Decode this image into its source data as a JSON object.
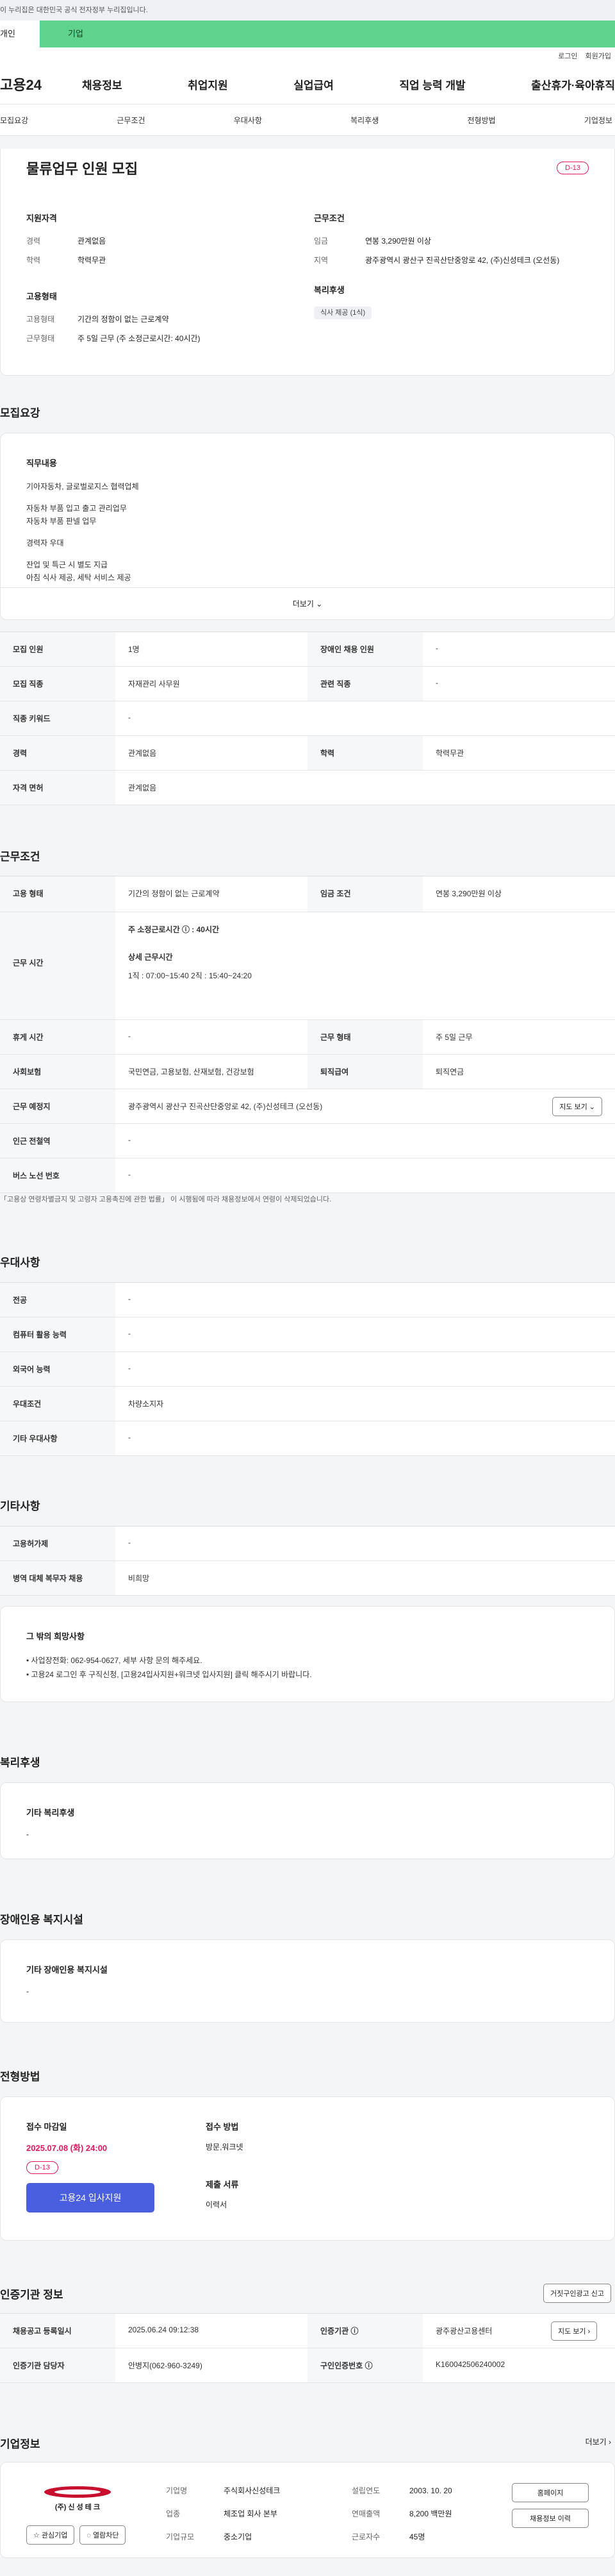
{
  "banner": "이 누리집은 대한민국 공식 전자정부 누리집입니다.",
  "tabs": {
    "person": "개인",
    "biz": "기업"
  },
  "util": {
    "login": "로그인",
    "signup": "회원가입"
  },
  "gnb": {
    "logo": "고용24",
    "menu": [
      "채용정보",
      "취업지원",
      "실업급여",
      "직업 능력 개발",
      "출산휴가·육아휴직"
    ]
  },
  "subnav": [
    "모집요강",
    "근무조건",
    "우대사항",
    "복리후생",
    "전형방법",
    "기업정보"
  ],
  "summary": {
    "title": "물류업무 인원 모집",
    "dday": "D-13",
    "qual_title": "지원자격",
    "career_lbl": "경력",
    "career": "관계없음",
    "edu_lbl": "학력",
    "edu": "학력무관",
    "cond_title": "근무조건",
    "wage_lbl": "임금",
    "wage": "연봉 3,290만원 이상",
    "region_lbl": "지역",
    "region": "광주광역시 광산구 진곡산단중앙로 42, (주)신성테크 (오선동)",
    "emp_title": "고용형태",
    "type_lbl": "고용형태",
    "type": "기간의 정함이 없는 근로계약",
    "hours_lbl": "근무형태",
    "hours": "주 5일 근무 (주 소정근로시간: 40시간)",
    "welfare_title": "복리후생",
    "welfare_tag": "식사 제공 (1식)"
  },
  "recruit": {
    "title": "모집요강",
    "box_title": "직무내용",
    "lines": [
      "기아자동차, 글로벌로지스 협력업체",
      "자동차 부품 입고 출고 관리업무",
      "자동차 부품 판넬 업무",
      "경력자 우대",
      "잔업 및 특근 시 별도 지급",
      "아침 식사 제공, 세탁 서비스 제공"
    ],
    "more": "더보기 ⌄",
    "rows": [
      {
        "l1": "모집 인원",
        "v1": "1명",
        "l2": "장애인 채용 인원",
        "v2": "-"
      },
      {
        "l1": "모집 직종",
        "v1": "자재관리 사무원",
        "l2": "관련 직종",
        "v2": "-"
      },
      {
        "l1": "직종 키워드",
        "v1": "-"
      },
      {
        "l1": "경력",
        "v1": "관계없음",
        "l2": "학력",
        "v2": "학력무관"
      },
      {
        "l1": "자격 면허",
        "v1": "관계없음"
      }
    ]
  },
  "workcond": {
    "title": "근무조건",
    "emp_lbl": "고용 형태",
    "emp": "기간의 정함이 없는 근로계약",
    "wage_lbl": "임금 조건",
    "wage": "연봉 3,290만원 이상",
    "hours_lbl": "근무 시간",
    "hours_main": "주 소정근로시간 ⓘ : 40시간",
    "hours_detail_lbl": "상세 근무시간",
    "hours_detail": "1직 : 07:00~15:40  2직 : 15:40~24:20",
    "rest_lbl": "휴게 시간",
    "rest": "-",
    "form_lbl": "근무 형태",
    "form": "주 5일 근무",
    "ins_lbl": "사회보험",
    "ins": "국민연금, 고용보험, 산재보험, 건강보험",
    "ret_lbl": "퇴직급여",
    "ret": "퇴직연금",
    "place_lbl": "근무 예정지",
    "place": "광주광역시 광산구 진곡산단중앙로 42, (주)신성테크 (오선동)",
    "map": "지도 보기 ⌄",
    "sub_lbl": "인근 전철역",
    "sub": "-",
    "bus_lbl": "버스 노선 번호",
    "bus": "-",
    "note": "「고용상 연령차별금지 및 고령자 고용촉진에 관한 법률」 이 시행됨에 따라 채용정보에서 연령이 삭제되었습니다."
  },
  "pref": {
    "title": "우대사항",
    "rows": [
      {
        "l": "전공",
        "v": "-"
      },
      {
        "l": "컴퓨터 활용 능력",
        "v": "-"
      },
      {
        "l": "외국어 능력",
        "v": "-"
      },
      {
        "l": "우대조건",
        "v": "차량소지자"
      },
      {
        "l": "기타 우대사항",
        "v": "-"
      }
    ]
  },
  "etc": {
    "title": "기타사항",
    "rows": [
      {
        "l": "고용허가제",
        "v": "-"
      },
      {
        "l": "병역 대체 복무자 채용",
        "v": "비희망"
      }
    ],
    "box_title": "그 밖의 희망사항",
    "lines": [
      "• 사업장전화: 062-954-0627, 세부 사항 문의 해주세요.",
      "• 고용24 로그인 후 구직신청, [고용24입사지원+워크넷 입사지원] 클릭 해주시기 바랍니다."
    ]
  },
  "benefit": {
    "title": "복리후생",
    "box_title": "기타 복리후생",
    "value": "-"
  },
  "disab": {
    "title": "장애인용 복지시설",
    "box_title": "기타 장애인용 복지시설",
    "value": "-"
  },
  "screen": {
    "title": "전형방법",
    "deadline_lbl": "접수 마감일",
    "deadline": "2025.07.08 (화) 24:00",
    "dday": "D-13",
    "apply": "고용24 입사지원",
    "method_lbl": "접수 방법",
    "method": "방문,워크넷",
    "docs_lbl": "제출 서류",
    "docs": "이력서"
  },
  "certify": {
    "title": "인증기관 정보",
    "report": "거짓구인광고 신고",
    "reg_lbl": "채용공고 등록일시",
    "reg": "2025.06.24 09:12:38",
    "org_lbl": "인증기관 ⓘ",
    "org": "광주광산고용센터",
    "map": "지도 보기 ›",
    "mgr_lbl": "인증기관 담당자",
    "mgr": "안병지(062-960-3249)",
    "cert_lbl": "구인인증번호 ⓘ",
    "cert": "K160042506240002"
  },
  "company": {
    "title": "기업정보",
    "more": "더보기 ›",
    "logo_text": "(주) 신 성 테 크",
    "fav": "☆ 관심기업",
    "block": "◌ 열람차단",
    "name_lbl": "기업명",
    "name": "주식회사신성테크",
    "year_lbl": "설립연도",
    "year": "2003. 10. 20",
    "ind_lbl": "업종",
    "ind": "체조업 회사 본부",
    "sales_lbl": "연매출액",
    "sales": "8,200 백만원",
    "size_lbl": "기업규모",
    "size": "중소기업",
    "emp_lbl": "근로자수",
    "emp": "45명",
    "home": "홈페이지",
    "jobs": "채용정보 이력"
  },
  "colors": {
    "accent": "#4a5fe0",
    "dday": "#e0195f",
    "biz_tab": "#5fd38d"
  }
}
